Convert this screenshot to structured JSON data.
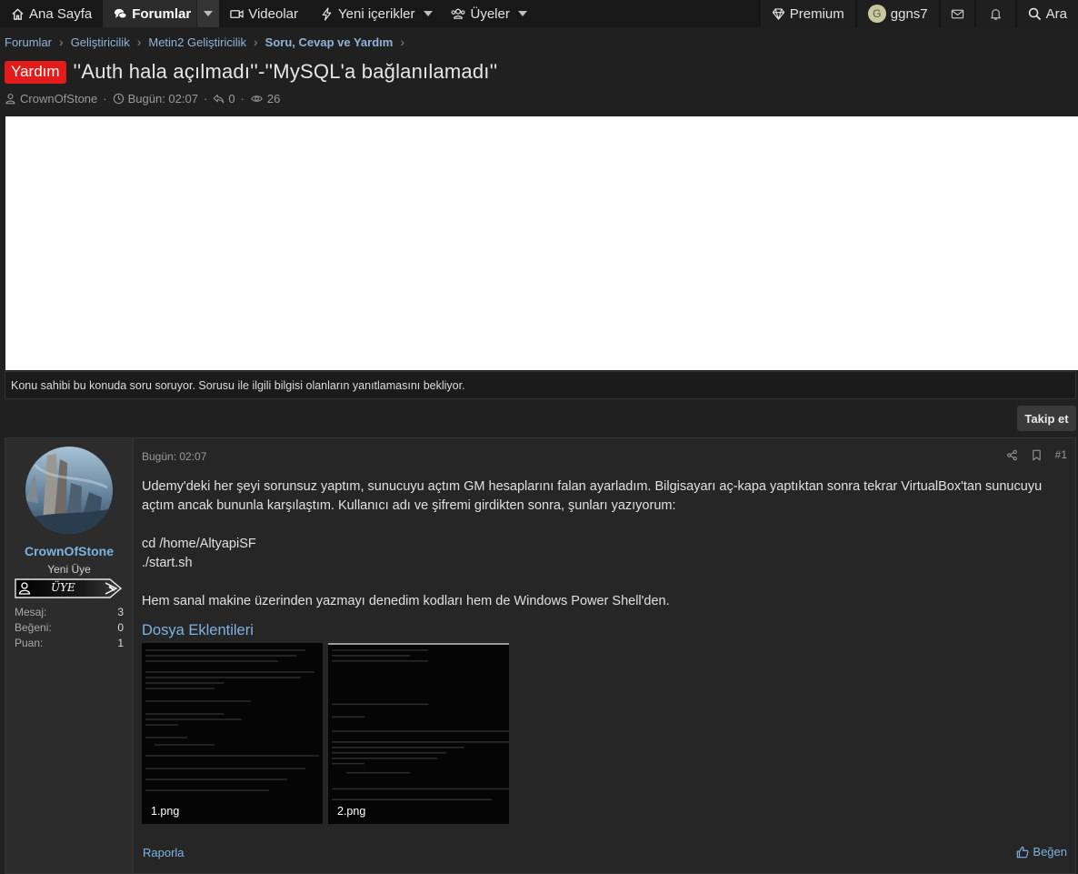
{
  "nav": {
    "home": "Ana Sayfa",
    "forums": "Forumlar",
    "videos": "Videolar",
    "new_content": "Yeni içerikler",
    "members": "Üyeler",
    "premium": "Premium",
    "user_initial": "G",
    "username": "ggns7",
    "search": "Ara"
  },
  "breadcrumb": [
    "Forumlar",
    "Geliştiricilik",
    "Metin2 Geliştiricilik",
    "Soru, Cevap ve Yardım"
  ],
  "thread": {
    "prefix": "Yardım",
    "title": "''Auth hala açılmadı''-''MySQL'a bağlanılamadı''",
    "author": "CrownOfStone",
    "date": "Bugün: 02:07",
    "replies": "0",
    "views": "26"
  },
  "notice": "Konu sahibi bu konuda soru soruyor. Sorusu ile ilgili bilgisi olanların yanıtlamasını bekliyor.",
  "follow_label": "Takip et",
  "post": {
    "user": {
      "name": "CrownOfStone",
      "title": "Yeni Üye",
      "rank": "ÜYE",
      "stats": [
        {
          "label": "Mesaj:",
          "value": "3"
        },
        {
          "label": "Beğeni:",
          "value": "0"
        },
        {
          "label": "Puan:",
          "value": "1"
        }
      ]
    },
    "date": "Bugün: 02:07",
    "number": "#1",
    "body": {
      "p1": "Udemy'deki her şeyi sorunsuz yaptım, sunucuyu açtım GM hesaplarını falan ayarladım. Bilgisayarı aç-kapa yaptıktan sonra tekrar VirtualBox'tan sunucuyu açtım ancak bununla karşılaştım. Kullanıcı adı ve şifremi girdikten sonra, şunları yazıyorum:",
      "code1": "cd /home/AltyapiSF",
      "code2": "./start.sh",
      "p2": "Hem sanal makine üzerinden yazmayı denedim kodları hem de Windows Power Shell'den."
    },
    "attachments_title": "Dosya Eklentileri",
    "attachments": [
      "1.png",
      "2.png"
    ],
    "report": "Raporla",
    "like": "Beğen"
  },
  "colors": {
    "accent_link": "#7db3e3",
    "prefix_red": "#e21b1b",
    "nav_bg": "#181818",
    "page_bg": "#202020"
  },
  "icons": [
    "home-icon",
    "comments-icon",
    "video-icon",
    "bolt-icon",
    "users-icon",
    "gem-icon",
    "envelope-icon",
    "bell-icon",
    "search-icon",
    "user-icon",
    "clock-icon",
    "reply-icon",
    "eye-icon",
    "share-icon",
    "bookmark-icon",
    "thumbs-up-icon"
  ]
}
